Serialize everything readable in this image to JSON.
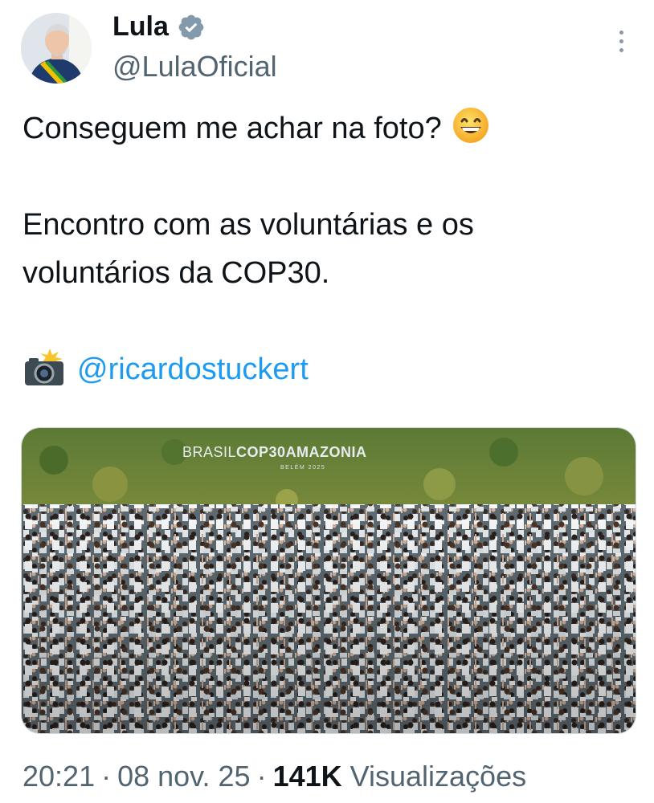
{
  "author": {
    "name": "Lula",
    "handle": "@LulaOficial",
    "verified_icon": "verified-badge-icon"
  },
  "tweet": {
    "line1": "Conseguem me achar na foto?",
    "line2a": "Encontro com as voluntárias e os",
    "line2b": "voluntários da COP30.",
    "mention": "@ricardostuckert"
  },
  "media": {
    "banner_brasil": "BRASIL",
    "banner_cop": "COP30",
    "banner_amazonia": "AMAZONIA",
    "banner_sub": "BELÉM 2025"
  },
  "meta": {
    "time": "20:21",
    "date": "08 nov. 25",
    "views_count": "141K",
    "views_label": "Visualizações"
  },
  "colors": {
    "link": "#1d9bf0",
    "text": "#0f1419",
    "secondary": "#536471"
  }
}
